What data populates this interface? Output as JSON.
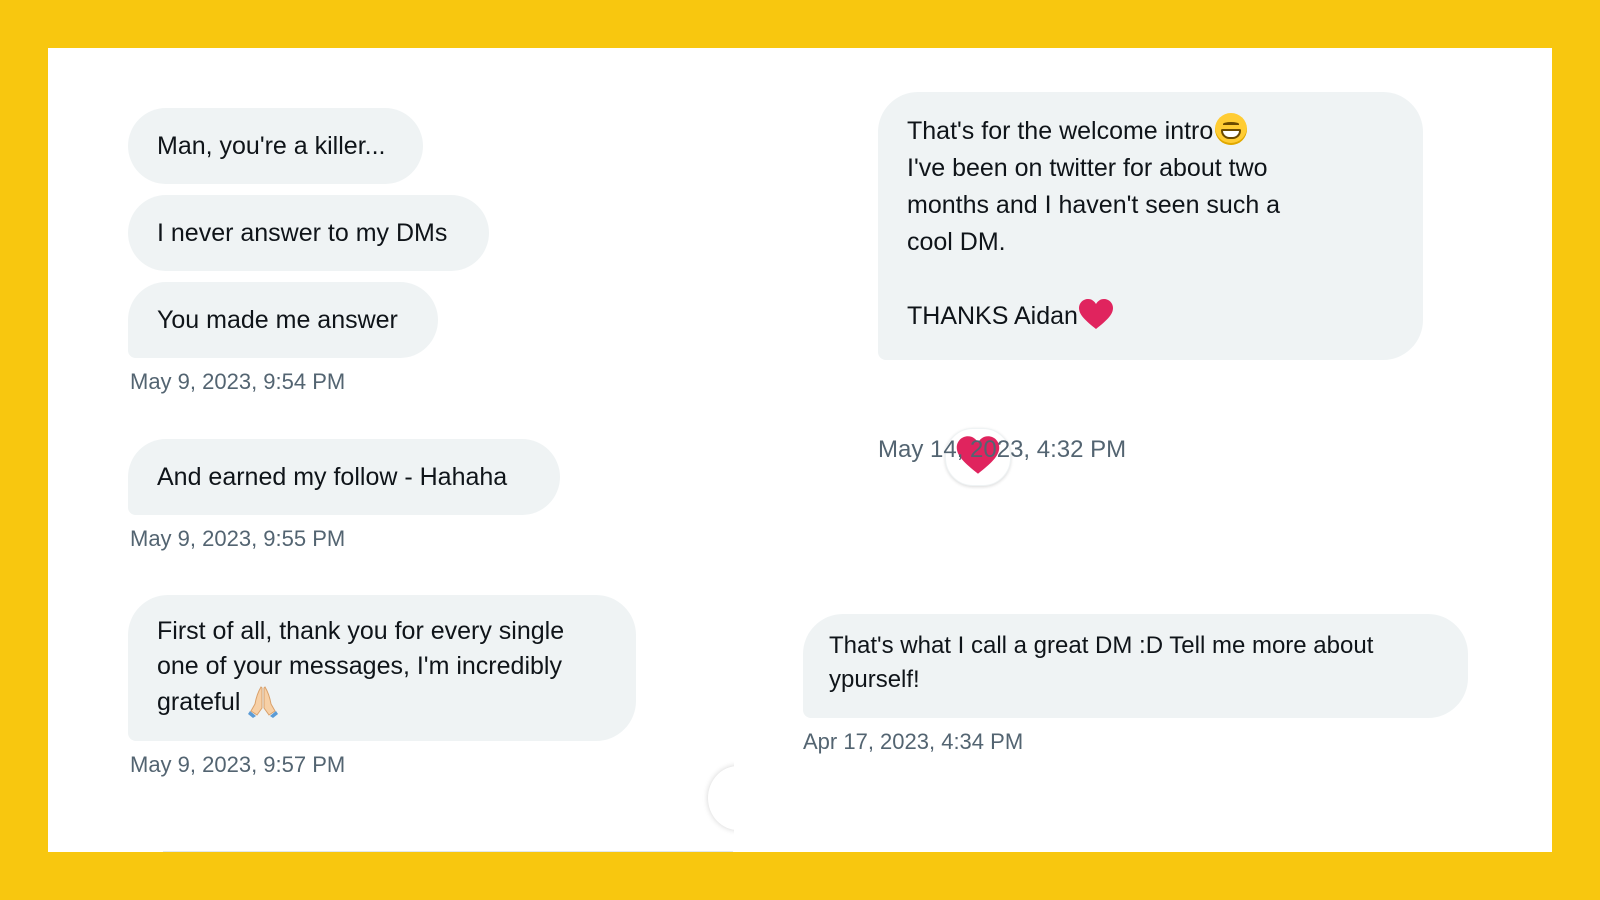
{
  "colors": {
    "frame": "#f8c70f",
    "bubble": "#eff3f4",
    "text": "#0f1419",
    "timestamp": "#536471",
    "heart": "#e0245e"
  },
  "left_thread": {
    "group1": {
      "messages": [
        "Man, you're a killer...",
        "I never answer to my DMs",
        "You made me answer"
      ],
      "timestamp": "May 9, 2023, 9:54 PM"
    },
    "group2": {
      "message": "And earned my follow - Hahaha",
      "timestamp": "May 9, 2023, 9:55 PM"
    },
    "group3": {
      "lines": [
        "First of all, thank you for every single",
        "one of your messages, I'm incredibly",
        "grateful"
      ],
      "emoji": "pray-icon",
      "timestamp": "May 9, 2023, 9:57 PM"
    }
  },
  "right_thread": {
    "group1": {
      "line1": "That's for the welcome intro",
      "line2": "I've been on twitter for about two",
      "line3": "months and I haven't seen such a",
      "line4": "cool DM.",
      "line5": "THANKS Aidan",
      "reaction": "heart-icon",
      "timestamp": "May 14, 2023, 4:32 PM"
    },
    "group2": {
      "lines": [
        "That's what I call a great DM :D Tell me more about",
        "ypurself!"
      ],
      "timestamp": "Apr 17, 2023, 4:34 PM"
    }
  }
}
